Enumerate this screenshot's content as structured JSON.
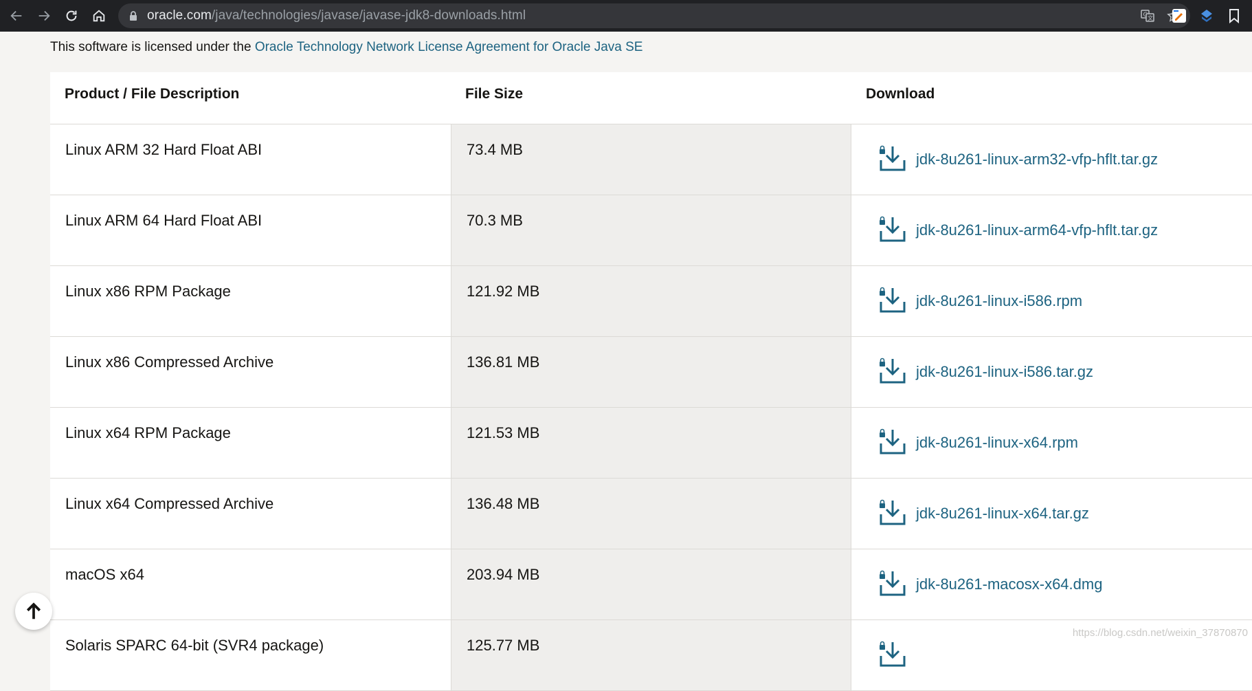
{
  "browser": {
    "url_host": "oracle.com",
    "url_path": "/java/technologies/javase/javase-jdk8-downloads.html",
    "icons": [
      "back-icon",
      "forward-icon",
      "reload-icon",
      "home-icon",
      "lock-icon",
      "translate-icon",
      "bookmark-star-icon",
      "extension-icon",
      "extension-icon",
      "bookmark-icon"
    ]
  },
  "license": {
    "prefix": "This software is licensed under the ",
    "link_text": "Oracle Technology Network License Agreement for Oracle Java SE"
  },
  "table": {
    "headers": {
      "product": "Product / File Description",
      "size": "File Size",
      "download": "Download"
    },
    "rows": [
      {
        "product": "Linux ARM 32 Hard Float ABI",
        "size": "73.4 MB",
        "file": "jdk-8u261-linux-arm32-vfp-hflt.tar.gz"
      },
      {
        "product": "Linux ARM 64 Hard Float ABI",
        "size": "70.3 MB",
        "file": "jdk-8u261-linux-arm64-vfp-hflt.tar.gz"
      },
      {
        "product": "Linux x86 RPM Package",
        "size": "121.92 MB",
        "file": "jdk-8u261-linux-i586.rpm"
      },
      {
        "product": "Linux x86 Compressed Archive",
        "size": "136.81 MB",
        "file": "jdk-8u261-linux-i586.tar.gz"
      },
      {
        "product": "Linux x64 RPM Package",
        "size": "121.53 MB",
        "file": "jdk-8u261-linux-x64.rpm"
      },
      {
        "product": "Linux x64 Compressed Archive",
        "size": "136.48 MB",
        "file": "jdk-8u261-linux-x64.tar.gz"
      },
      {
        "product": "macOS x64",
        "size": "203.94 MB",
        "file": "jdk-8u261-macosx-x64.dmg"
      },
      {
        "product": "Solaris SPARC 64-bit (SVR4 package)",
        "size": "125.77 MB",
        "file": ""
      }
    ]
  },
  "watermark": "https://blog.csdn.net/weixin_37870870",
  "colors": {
    "link": "#1d6381",
    "toolbar": "#202124",
    "page_bg": "#f5f4f2",
    "size_col_bg": "#efeeec"
  }
}
